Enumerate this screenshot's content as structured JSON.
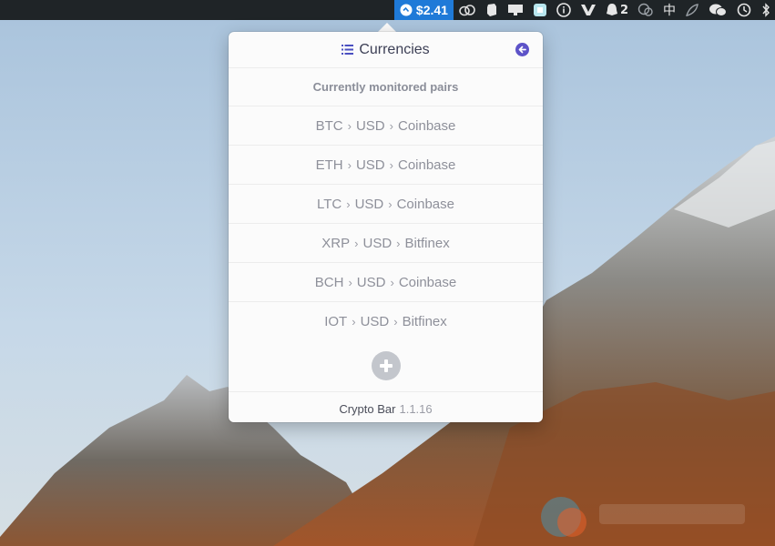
{
  "menubar": {
    "price": "$2.41",
    "notification_count": "2",
    "input_method": "中"
  },
  "popover": {
    "title": "Currencies",
    "subtitle": "Currently monitored pairs",
    "pairs": [
      {
        "coin": "BTC",
        "fiat": "USD",
        "exchange": "Coinbase"
      },
      {
        "coin": "ETH",
        "fiat": "USD",
        "exchange": "Coinbase"
      },
      {
        "coin": "LTC",
        "fiat": "USD",
        "exchange": "Coinbase"
      },
      {
        "coin": "XRP",
        "fiat": "USD",
        "exchange": "Bitfinex"
      },
      {
        "coin": "BCH",
        "fiat": "USD",
        "exchange": "Coinbase"
      },
      {
        "coin": "IOT",
        "fiat": "USD",
        "exchange": "Bitfinex"
      }
    ],
    "separator": "›",
    "app_name": "Crypto Bar",
    "version": "1.1.16"
  },
  "colors": {
    "menubar_bg": "#1f2427",
    "status_item_bg": "#1f7ad8",
    "accent": "#5d53c8",
    "add_button": "#c3c6cc"
  },
  "icons": {
    "status": "crypto-bar-icon",
    "header": "list-icon",
    "back": "back-arrow-icon",
    "add": "plus-icon"
  }
}
